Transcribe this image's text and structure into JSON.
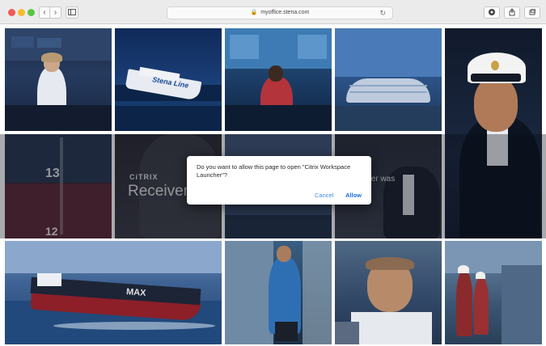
{
  "browser": {
    "address": "myoffice.stena.com",
    "icons": {
      "back": "chevron-left-icon",
      "forward": "chevron-right-icon",
      "sidebar": "sidebar-icon",
      "lock": "lock-icon",
      "reload": "reload-icon",
      "extension": "extension-icon",
      "share": "share-icon",
      "tabs": "tabs-icon"
    }
  },
  "tiles": {
    "ship_banner": "Stena Line",
    "tanker_label": "MAX",
    "citrix_brand": "CiTRIX",
    "receiver_label": "Receiver",
    "receiver_tail": "eiver was",
    "clock_numbers": [
      "13",
      "12"
    ]
  },
  "dialog": {
    "message": "Do you want to allow this page to open \"Citrix Workspace Launcher\"?",
    "cancel_label": "Cancel",
    "allow_label": "Allow"
  },
  "colors": {
    "accent": "#1a6fe0",
    "navy_tint": "#1b2c4a"
  }
}
